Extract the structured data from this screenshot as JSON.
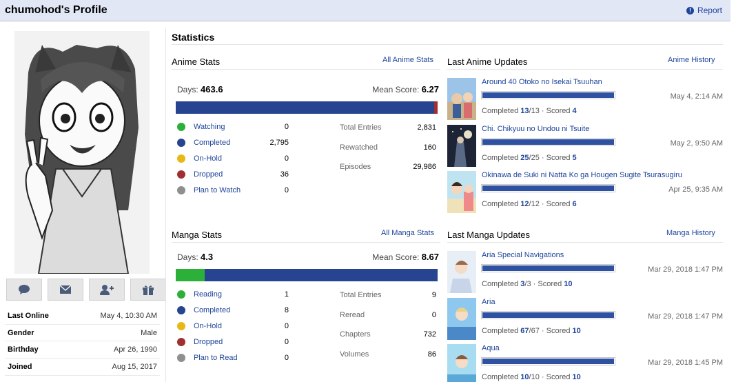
{
  "header": {
    "title": "chumohod's Profile",
    "report_label": "Report"
  },
  "actions": [
    {
      "name": "comment-button",
      "icon": "speech-bubble-icon"
    },
    {
      "name": "message-button",
      "icon": "envelope-icon"
    },
    {
      "name": "add-friend-button",
      "icon": "add-user-icon"
    },
    {
      "name": "gift-button",
      "icon": "gift-icon"
    }
  ],
  "info": [
    {
      "key": "Last Online",
      "value": "May 4, 10:30 AM"
    },
    {
      "key": "Gender",
      "value": "Male"
    },
    {
      "key": "Birthday",
      "value": "Apr 26, 1990"
    },
    {
      "key": "Joined",
      "value": "Aug 15, 2017"
    }
  ],
  "statistics": {
    "title": "Statistics",
    "anime": {
      "heading": "Anime Stats",
      "link": "All Anime Stats",
      "days_label": "Days:",
      "days": "463.6",
      "mean_label": "Mean Score:",
      "mean": "6.27",
      "statuses": [
        {
          "label": "Watching",
          "value": "0",
          "color": "#2db039"
        },
        {
          "label": "Completed",
          "value": "2,795",
          "color": "#26448f"
        },
        {
          "label": "On-Hold",
          "value": "0",
          "color": "#f9d457"
        },
        {
          "label": "Dropped",
          "value": "36",
          "color": "#a12f31"
        },
        {
          "label": "Plan to Watch",
          "value": "0",
          "color": "#8f8f8f"
        }
      ],
      "totals": [
        {
          "label": "Total Entries",
          "value": "2,831"
        },
        {
          "label": "Rewatched",
          "value": "160"
        },
        {
          "label": "Episodes",
          "value": "29,986"
        }
      ]
    },
    "manga": {
      "heading": "Manga Stats",
      "link": "All Manga Stats",
      "days_label": "Days:",
      "days": "4.3",
      "mean_label": "Mean Score:",
      "mean": "8.67",
      "statuses": [
        {
          "label": "Reading",
          "value": "1",
          "color": "#2db039"
        },
        {
          "label": "Completed",
          "value": "8",
          "color": "#26448f"
        },
        {
          "label": "On-Hold",
          "value": "0",
          "color": "#f9d457"
        },
        {
          "label": "Dropped",
          "value": "0",
          "color": "#a12f31"
        },
        {
          "label": "Plan to Read",
          "value": "0",
          "color": "#8f8f8f"
        }
      ],
      "totals": [
        {
          "label": "Total Entries",
          "value": "9"
        },
        {
          "label": "Reread",
          "value": "0"
        },
        {
          "label": "Chapters",
          "value": "732"
        },
        {
          "label": "Volumes",
          "value": "86"
        }
      ]
    }
  },
  "anime_updates": {
    "heading": "Last Anime Updates",
    "link": "Anime History",
    "items": [
      {
        "title": "Around 40 Otoko no Isekai Tsuuhan",
        "date": "May 4, 2:14 AM",
        "status": "Completed",
        "progress": "13",
        "total": "13",
        "score_label": "Scored",
        "score": "4"
      },
      {
        "title": "Chi. Chikyuu no Undou ni Tsuite",
        "date": "May 2, 9:50 AM",
        "status": "Completed",
        "progress": "25",
        "total": "25",
        "score_label": "Scored",
        "score": "5"
      },
      {
        "title": "Okinawa de Suki ni Natta Ko ga Hougen Sugite Tsurasugiru",
        "date": "Apr 25, 9:35 AM",
        "status": "Completed",
        "progress": "12",
        "total": "12",
        "score_label": "Scored",
        "score": "6"
      }
    ]
  },
  "manga_updates": {
    "heading": "Last Manga Updates",
    "link": "Manga History",
    "items": [
      {
        "title": "Aria Special Navigations",
        "date": "Mar 29, 2018 1:47 PM",
        "status": "Completed",
        "progress": "3",
        "total": "3",
        "score_label": "Scored",
        "score": "10"
      },
      {
        "title": "Aria",
        "date": "Mar 29, 2018 1:47 PM",
        "status": "Completed",
        "progress": "67",
        "total": "67",
        "score_label": "Scored",
        "score": "10"
      },
      {
        "title": "Aqua",
        "date": "Mar 29, 2018 1:45 PM",
        "status": "Completed",
        "progress": "10",
        "total": "10",
        "score_label": "Scored",
        "score": "10"
      }
    ]
  }
}
